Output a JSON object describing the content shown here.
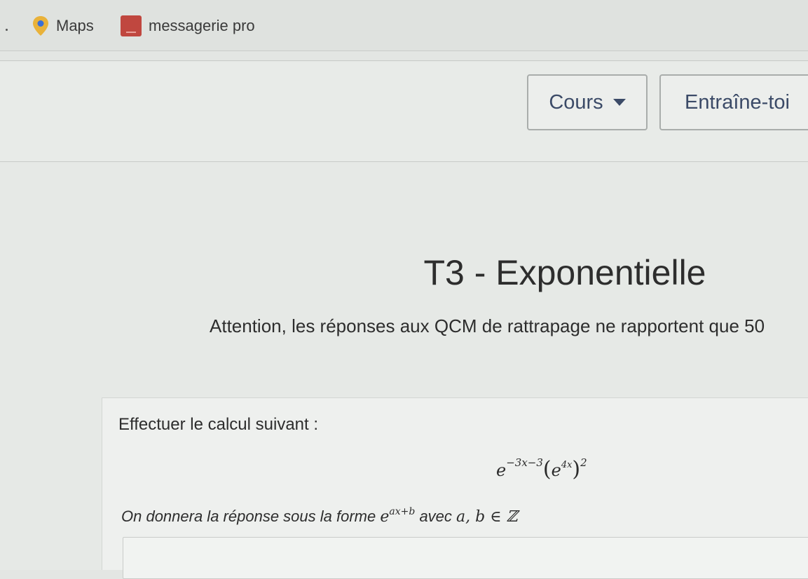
{
  "bookmarks": [
    {
      "label": "Maps",
      "icon": "map-pin-icon"
    },
    {
      "label": "messagerie pro",
      "icon": "mail-icon"
    }
  ],
  "nav": {
    "cours_label": "Cours",
    "entraine_label": "Entraîne-toi"
  },
  "page": {
    "title": "T3 - Exponentielle",
    "warning": "Attention, les réponses aux QCM de rattrapage ne rapportent que 50"
  },
  "exercise": {
    "instruction": "Effectuer le calcul suivant :",
    "formula": {
      "base": "e",
      "exponent": "−3x−3",
      "inner_base": "e",
      "inner_exponent": "4x",
      "outer_power": "2"
    },
    "answer_prefix": "On donnera la réponse sous la forme",
    "answer_form_base": "e",
    "answer_form_exponent": "ax+b",
    "answer_suffix": "avec",
    "answer_condition": "a, b ∈ ℤ"
  },
  "colors": {
    "nav_text": "#3b4a67",
    "mail_icon": "#c0473f",
    "map_pin": "#e9b23a"
  }
}
